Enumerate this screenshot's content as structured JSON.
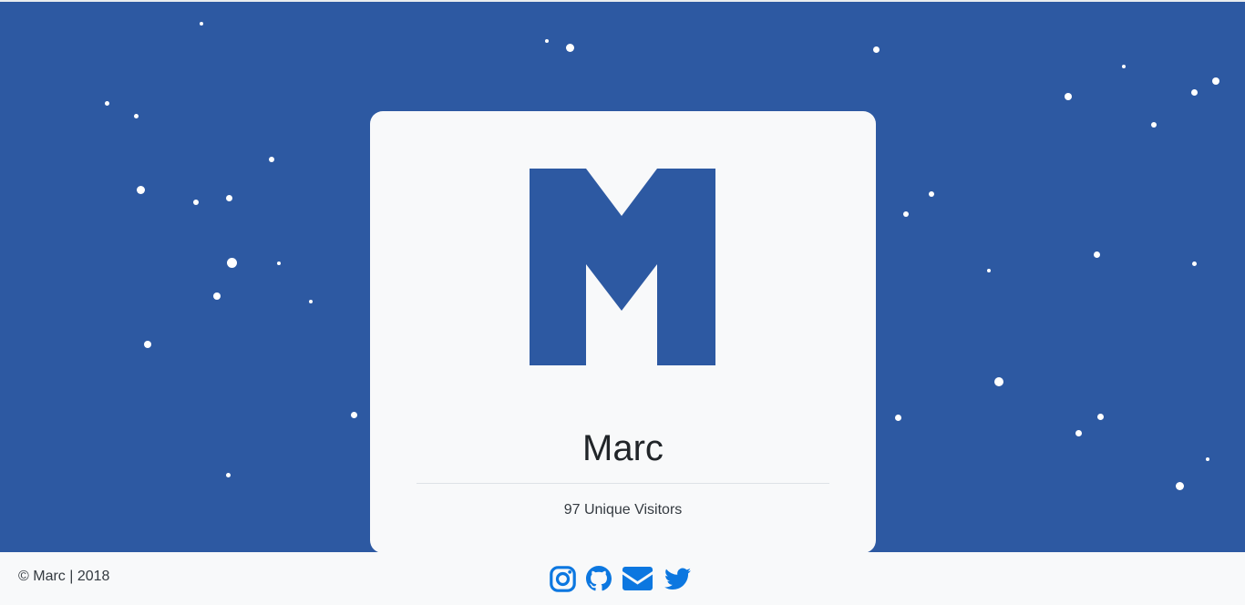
{
  "card": {
    "logo_letter": "M",
    "name": "Marc",
    "visitors": "97 Unique Visitors"
  },
  "footer": {
    "copyright": "© Marc | 2018",
    "social": [
      {
        "icon": "instagram-icon",
        "label": "Instagram"
      },
      {
        "icon": "github-icon",
        "label": "GitHub"
      },
      {
        "icon": "email-icon",
        "label": "Email"
      },
      {
        "icon": "twitter-icon",
        "label": "Twitter"
      }
    ]
  },
  "colors": {
    "background": "#2d59a2",
    "card": "#f8f9fa",
    "accent": "#0c77e0",
    "text": "#212529"
  }
}
